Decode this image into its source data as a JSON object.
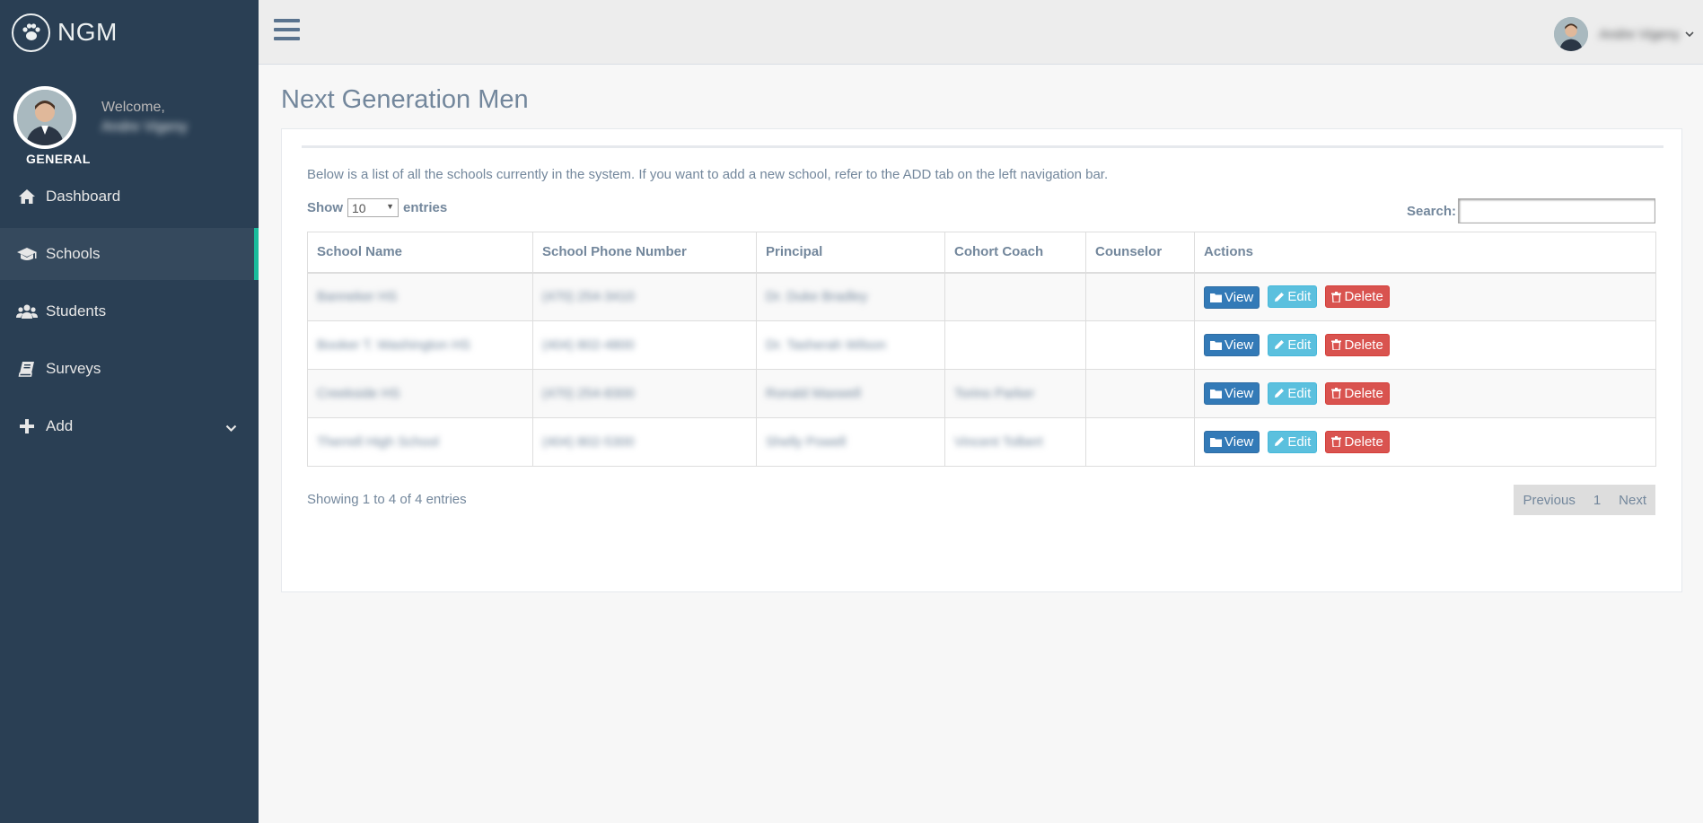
{
  "brand": {
    "name": "NGM",
    "logo_icon": "paw-icon"
  },
  "profile": {
    "welcome": "Welcome,",
    "name": "Andre Vigeny",
    "role": "GENERAL"
  },
  "sidebar": {
    "items": [
      {
        "label": "Dashboard",
        "icon": "home-icon"
      },
      {
        "label": "Schools",
        "icon": "graduation-cap-icon",
        "active": true
      },
      {
        "label": "Students",
        "icon": "users-icon"
      },
      {
        "label": "Surveys",
        "icon": "book-icon"
      },
      {
        "label": "Add",
        "icon": "plus-icon"
      }
    ]
  },
  "topbar": {
    "user_name": "Andre Vigeny"
  },
  "main": {
    "title": "Next Generation Men",
    "intro": "Below is a list of all the schools currently in the system. If you want to add a new school, refer to the ADD tab on the left navigation bar.",
    "length": {
      "show": "Show",
      "value": "10",
      "entries": "entries"
    },
    "search_label": "Search:",
    "table": {
      "headers": [
        "School Name",
        "School Phone Number",
        "Principal",
        "Cohort Coach",
        "Counselor",
        "Actions"
      ],
      "rows": [
        {
          "school": "Banneker HS",
          "phone": "(470) 254-3410",
          "principal": "Dr. Duke Bradley",
          "coach": "",
          "counselor": ""
        },
        {
          "school": "Booker T. Washington HS",
          "phone": "(404) 802-4800",
          "principal": "Dr. Tasherah Wilson",
          "coach": "",
          "counselor": ""
        },
        {
          "school": "Creekside HS",
          "phone": "(470) 254-8300",
          "principal": "Ronald Maxwell",
          "coach": "Torino Parker",
          "counselor": ""
        },
        {
          "school": "Therrell High School",
          "phone": "(404) 802-5300",
          "principal": "Shelly Powell",
          "coach": "Vincent Tolbert",
          "counselor": ""
        }
      ],
      "actions": {
        "view": "View",
        "edit": "Edit",
        "delete": "Delete"
      }
    },
    "info": "Showing 1 to 4 of 4 entries",
    "pager": {
      "previous": "Previous",
      "page": "1",
      "next": "Next"
    }
  },
  "colors": {
    "sidebar": "#2a3f54",
    "active_accent": "#1abb9c",
    "view": "#337ab7",
    "edit": "#5bc0de",
    "delete": "#d9534f"
  }
}
